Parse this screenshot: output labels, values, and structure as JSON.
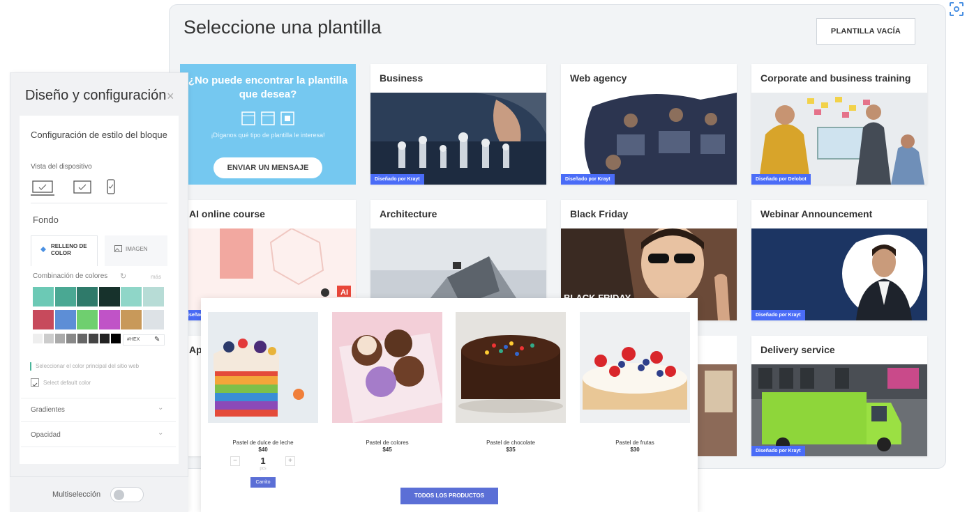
{
  "templates_panel": {
    "title": "Seleccione una plantilla",
    "blank_button": "PLANTILLA VACÍA"
  },
  "cta_card": {
    "title": "¿No puede encontrar la plantilla que desea?",
    "subtitle": "¡Díganos qué tipo de plantilla le interesa!",
    "button": "ENVIAR UN MENSAJE"
  },
  "templates": [
    {
      "title": "Business",
      "badge": "Diseñado por Krayt"
    },
    {
      "title": "Web agency",
      "badge": "Diseñado por Krayt"
    },
    {
      "title": "Corporate and business training",
      "badge": "Diseñado por Delobot"
    },
    {
      "title": "AI online course",
      "badge": "Diseñado"
    },
    {
      "title": "Architecture",
      "badge": ""
    },
    {
      "title": "Black Friday",
      "badge": "",
      "banner": "BLACK FRIDAY"
    },
    {
      "title": "Webinar Announcement",
      "badge": "Diseñado por Krayt"
    },
    {
      "title": "Ap",
      "badge": ""
    },
    {
      "title": "Delivery service",
      "badge": "Diseñado por Krayt"
    }
  ],
  "settings": {
    "title": "Diseño y configuración",
    "block_style": "Configuración de estilo del bloque",
    "device_view": "Vista del dispositivo",
    "background": "Fondo",
    "tab_fill": "RELLENO DE COLOR",
    "tab_image": "IMAGEN",
    "color_combo": "Combinación de colores",
    "more": "más",
    "hex_label": "#HEX",
    "main_color": "Seleccionar el color principal del sitio web",
    "default_color": "Select default color",
    "gradients": "Gradientes",
    "opacity": "Opacidad",
    "multiselect": "Multiselección",
    "swatches_row1": [
      "#6cc9b5",
      "#4aa893",
      "#2f7a6a",
      "#17322c",
      "#8fd6c8",
      "#b7dcd6"
    ],
    "swatches_row2": [
      "#c74a5c",
      "#5d8ed6",
      "#6fcf6f",
      "#c053c7",
      "#c8995a",
      "#dde2e6"
    ],
    "swatches_gray": [
      "#eeeeee",
      "#cccccc",
      "#aaaaaa",
      "#888888",
      "#666666",
      "#444444",
      "#222222",
      "#000000"
    ]
  },
  "shop": {
    "products": [
      {
        "name": "Pastel de dulce de leche",
        "price": "$40"
      },
      {
        "name": "Pastel de colores",
        "price": "$45"
      },
      {
        "name": "Pastel de chocolate",
        "price": "$35"
      },
      {
        "name": "Pastel de frutas",
        "price": "$30"
      }
    ],
    "qty": "1",
    "qty_unit": "pcs",
    "minus": "−",
    "plus": "+",
    "cart_button": "Carrito",
    "all_products": "TODOS LOS PRODUCTOS"
  }
}
